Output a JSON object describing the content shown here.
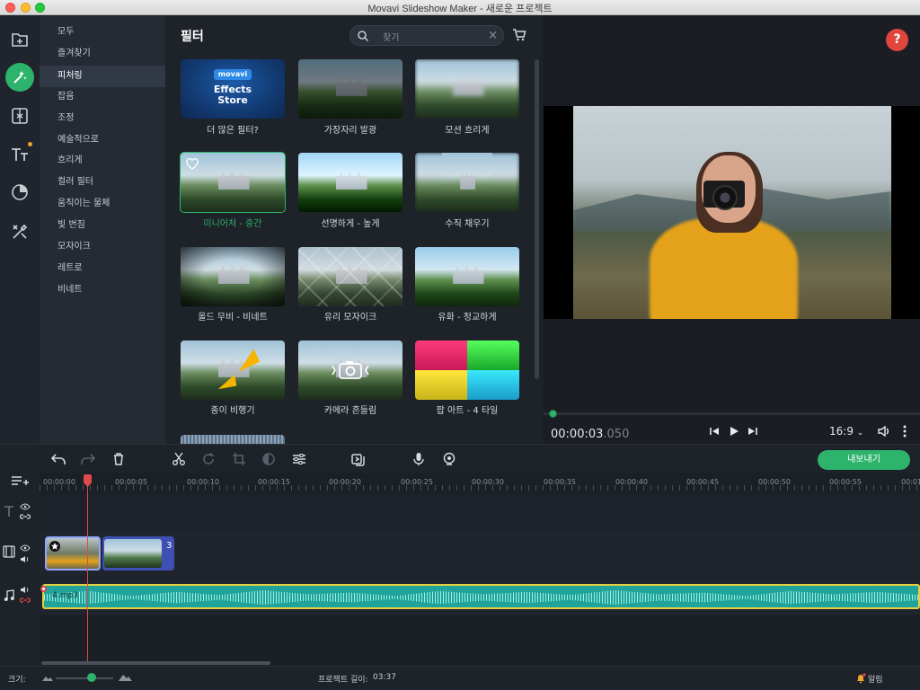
{
  "window": {
    "title": "Movavi Slideshow Maker - 새로운 프로젝트"
  },
  "colors": {
    "accent": "#2db36b",
    "help": "#e0463d",
    "playhead": "#e04a4a",
    "audio": "#1fa39a"
  },
  "toolbar_icons": [
    "import-icon",
    "filters-icon",
    "transitions-icon",
    "titles-icon",
    "stickers-icon",
    "more-tools-icon"
  ],
  "categories": [
    "모두",
    "즐겨찾기",
    "피처링",
    "잡음",
    "조정",
    "예술적으로",
    "흐리게",
    "컬러 필터",
    "움직이는 물체",
    "빛 번짐",
    "모자이크",
    "레트로",
    "비네트"
  ],
  "selected_category": "피처링",
  "filters_panel": {
    "title": "필터",
    "search_placeholder": "찾기",
    "store_tile": {
      "brand": "movavi",
      "line1": "Effects",
      "line2": "Store"
    },
    "tiles": [
      {
        "label": "더 많은 필터?"
      },
      {
        "label": "가장자리 발광"
      },
      {
        "label": "모션 흐리게"
      },
      {
        "label": "미니어처 - 중간",
        "selected": true
      },
      {
        "label": "선명하게 - 높게"
      },
      {
        "label": "수직 채우기"
      },
      {
        "label": "올드 무비 - 비네트"
      },
      {
        "label": "유리 모자이크"
      },
      {
        "label": "유화 - 정교하게"
      },
      {
        "label": "종이 비행기"
      },
      {
        "label": "카메라 흔들림"
      },
      {
        "label": "팝 아트 - 4 타일"
      }
    ]
  },
  "preview": {
    "help_label": "?",
    "time_main": "00:00:03",
    "time_ms": ".050",
    "aspect_ratio": "16:9"
  },
  "timeline": {
    "export_label": "내보내기",
    "ruler": [
      "00:00:00",
      "00:00:05",
      "00:00:10",
      "00:00:15",
      "00:00:20",
      "00:00:25",
      "00:00:30",
      "00:00:35",
      "00:00:40",
      "00:00:45",
      "00:00:50",
      "00:00:55",
      "00:01"
    ],
    "clip_count": "3",
    "audio_name": "4.mp3"
  },
  "status": {
    "size_label": "크기:",
    "project_length_label": "프로젝트 길이:",
    "project_length": "03:37",
    "notifications": "알림"
  }
}
